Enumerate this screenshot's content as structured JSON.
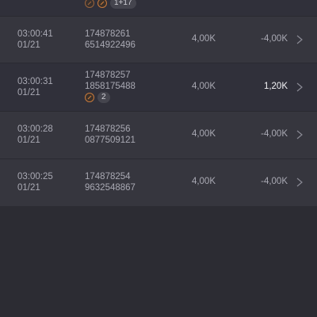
{
  "rows": [
    {
      "time": "",
      "date": "",
      "ticket_line1": "",
      "ticket_line2": "",
      "stake": "",
      "win": "",
      "badge_count": "1+17"
    },
    {
      "time": "03:00:41",
      "date": "01/21",
      "ticket_line1": "174878261",
      "ticket_line2": "6514922496",
      "stake": "4,00K",
      "win": "-4,00K"
    },
    {
      "time": "03:00:31",
      "date": "01/21",
      "ticket_line1": "174878257",
      "ticket_line2": "1858175488",
      "stake": "4,00K",
      "win": "1,20K",
      "badge_count": "2"
    },
    {
      "time": "03:00:28",
      "date": "01/21",
      "ticket_line1": "174878256",
      "ticket_line2": "0877509121",
      "stake": "4,00K",
      "win": "-4,00K"
    },
    {
      "time": "03:00:25",
      "date": "01/21",
      "ticket_line1": "174878254",
      "ticket_line2": "9632548867",
      "stake": "4,00K",
      "win": "-4,00K"
    }
  ],
  "colors": {
    "background": "#2c2c33",
    "row_alt": "#36363e",
    "text_muted": "#a9a9b3",
    "text_positive": "#f3f3f6",
    "coin_accent": "#c87a3c"
  }
}
